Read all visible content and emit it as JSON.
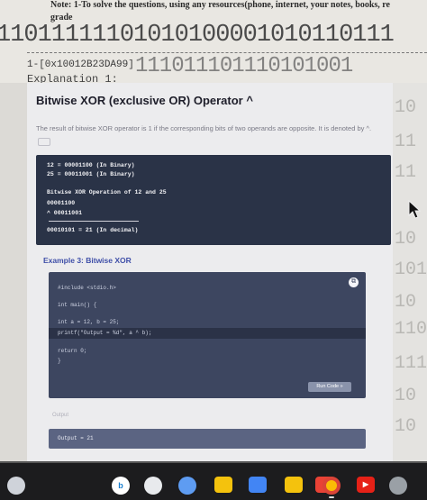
{
  "paper": {
    "note": "Note: 1-To solve the questions, using any resources(phone, internet, your notes, books, re",
    "grade": "grade",
    "binary_line_1": "11011111101010100001010110111",
    "hex_line": "1-[0x10012B23DA99]",
    "binary_line_2": "111011101110101001",
    "explanation": "Explanation 1:"
  },
  "side_binary": [
    "10",
    "11",
    "11",
    "10",
    "101",
    "10",
    "110",
    "111",
    "10",
    "10"
  ],
  "article": {
    "title": "Bitwise XOR (exclusive OR) Operator ^",
    "description": "The result of bitwise XOR operator is 1 if the corresponding bits of two operands are opposite. It is denoted by ^.",
    "code_block_1": [
      "12 = 00001100 (In Binary)",
      "25 = 00011001 (In Binary)",
      "",
      "Bitwise XOR Operation of 12 and 25",
      "  00001100",
      "^ 00011001",
      "",
      "  00010101  = 21 (In decimal)"
    ],
    "example_title": "Example 3: Bitwise XOR",
    "code_block_2": [
      "#include <stdio.h>",
      "",
      "int main() {",
      "",
      "    int a = 12, b = 25;",
      "    printf(\"Output = %d\", a ^ b);",
      "",
      "    return 0;",
      "}"
    ],
    "copy_icon": "copy-icon",
    "run_button": "Run Code »",
    "output_label": "Output",
    "output_value": "Output = 21"
  },
  "taskbar": {
    "items": [
      "launcher",
      "bing",
      "messages",
      "files",
      "store",
      "files-alt",
      "photos",
      "chrome",
      "youtube",
      "settings"
    ],
    "colors": {
      "bing": "#ffffff",
      "messages": "#5e9cf2",
      "files": "#f4c20d",
      "store": "#4285f4",
      "chrome": "#db4437",
      "youtube": "#e62117"
    }
  }
}
